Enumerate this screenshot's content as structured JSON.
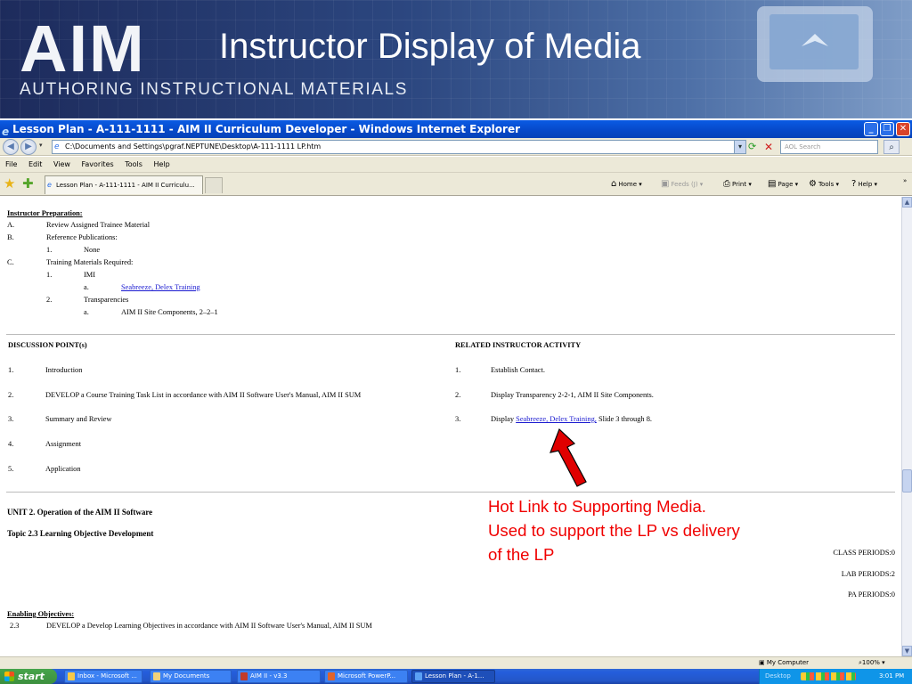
{
  "banner": {
    "logo": "AIM",
    "subtitle": "AUTHORING INSTRUCTIONAL MATERIALS",
    "slide_title": "Instructor Display of Media"
  },
  "window": {
    "title": "Lesson Plan - A-111-1111 - AIM II Curriculum Developer - Windows Internet Explorer",
    "address": "C:\\Documents and Settings\\pgraf.NEPTUNE\\Desktop\\A-111-1111 LP.htm",
    "search_placeholder": "AOL Search",
    "menu": [
      "File",
      "Edit",
      "View",
      "Favorites",
      "Tools",
      "Help"
    ],
    "tab_label": "Lesson Plan - A-111-1111 - AIM II Curriculu...",
    "commands": {
      "home": "Home",
      "feeds": "Feeds (J)",
      "print": "Print",
      "page": "Page",
      "tools": "Tools",
      "help": "Help"
    }
  },
  "content": {
    "prep_heading": "Instructor Preparation:",
    "prep": [
      {
        "marker": "A.",
        "text": "Review Assigned Trainee Material"
      },
      {
        "marker": "B.",
        "text": "Reference Publications:"
      },
      {
        "marker": "1.",
        "text": "None"
      },
      {
        "marker": "C.",
        "text": "Training Materials Required:"
      },
      {
        "marker": "1.",
        "text": "IMI"
      },
      {
        "marker": "a.",
        "text": "Seabreeze, Delex Training"
      },
      {
        "marker": "2.",
        "text": "Transparencies"
      },
      {
        "marker": "a.",
        "text": "AIM II Site Components, 2–2–1"
      }
    ],
    "col_left_heading": "DISCUSSION POINT(s)",
    "col_right_heading": "RELATED INSTRUCTOR ACTIVITY",
    "points": [
      {
        "num": "1.",
        "text": "Introduction"
      },
      {
        "num": "2.",
        "text": "DEVELOP a Course Training Task List in accordance with AIM II Software User's Manual, AIM II SUM"
      },
      {
        "num": "3.",
        "text": "Summary and Review"
      },
      {
        "num": "4.",
        "text": "Assignment"
      },
      {
        "num": "5.",
        "text": "Application"
      }
    ],
    "activities": [
      {
        "num": "1.",
        "text": "Establish Contact."
      },
      {
        "num": "2.",
        "text": "Display Transparency 2-2-1, AIM II Site Components."
      },
      {
        "num": "3.",
        "prefix": "Display",
        "link": "Seabreeze, Delex Training,",
        "suffix": "Slide 3 through 8."
      }
    ],
    "unit_title": "UNIT 2. Operation of the AIM II Software",
    "topic_title": "Topic 2.3 Learning Objective Development",
    "periods": {
      "class": "CLASS PERIODS:0",
      "lab": "LAB PERIODS:2",
      "pa": "PA PERIODS:0"
    },
    "enabling_heading": "Enabling Objectives:",
    "enabling": {
      "num": "2.3",
      "text": "DEVELOP a Develop Learning Objectives in accordance with AIM II Software User's Manual, AIM II SUM"
    }
  },
  "annotation": {
    "lines": [
      "Hot Link to Supporting Media.",
      "Used to support the LP vs delivery",
      "of the LP"
    ],
    "color": "#f00000"
  },
  "statusbar": {
    "zone": "My Computer",
    "zoom": "100%"
  },
  "taskbar": {
    "start": "start",
    "tasks": [
      "Inbox - Microsoft ...",
      "My Documents",
      "AIM II - v3.3",
      "Microsoft PowerP...",
      "Lesson Plan - A-1..."
    ],
    "desktop": "Desktop",
    "clock": "3:01 PM"
  }
}
